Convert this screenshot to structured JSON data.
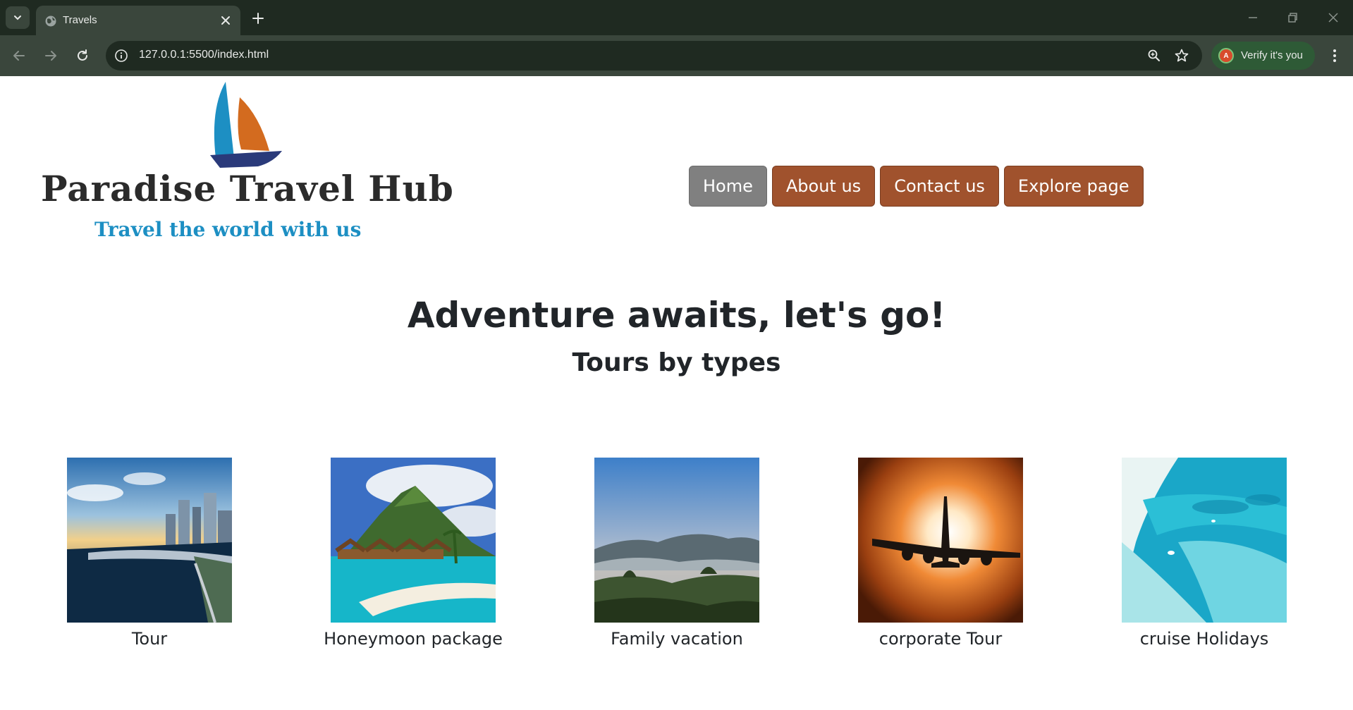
{
  "browser": {
    "tab_title": "Travels",
    "url": "127.0.0.1:5500/index.html",
    "profile_label": "Verify it's you",
    "profile_initial": "A",
    "colors": {
      "frame": "#1f2a21",
      "toolbar": "#3a463c",
      "profile_chip": "#2e5a36",
      "avatar": "#d84b2c"
    }
  },
  "header": {
    "logo_title": "Paradise Travel Hub",
    "logo_tagline": "Travel the world with us",
    "nav": [
      {
        "label": "Home",
        "active": true
      },
      {
        "label": "About us",
        "active": false
      },
      {
        "label": "Contact us",
        "active": false
      },
      {
        "label": "Explore page",
        "active": false
      }
    ],
    "colors": {
      "nav_button": "#a0522d",
      "nav_active": "#808080",
      "tagline": "#1d8fc3"
    }
  },
  "hero": {
    "title": "Adventure awaits, let's go!",
    "subtitle": "Tours by types"
  },
  "tours": [
    {
      "label": "Tour",
      "image_icon": "city-waterfront-image"
    },
    {
      "label": "Honeymoon package",
      "image_icon": "tropical-island-image"
    },
    {
      "label": "Family vacation",
      "image_icon": "misty-mountains-image"
    },
    {
      "label": "corporate Tour",
      "image_icon": "airplane-sunset-image"
    },
    {
      "label": "cruise Holidays",
      "image_icon": "turquoise-beach-image"
    }
  ]
}
